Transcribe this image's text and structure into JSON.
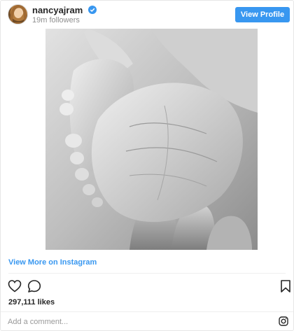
{
  "post": {
    "username": "nancyajram",
    "followers": "19m followers",
    "view_profile_label": "View Profile",
    "view_more_label": "View More on Instagram",
    "likes": "297,111 likes",
    "comment_placeholder": "Add a comment...",
    "photo_description_icon": "baby-feet-photo"
  },
  "colors": {
    "accent": "#3897f0",
    "text": "#262626",
    "muted": "#8e8e8e",
    "border": "#e6e6e6"
  },
  "icons": [
    "verified-badge-icon",
    "heart-icon",
    "comment-icon",
    "bookmark-icon",
    "instagram-icon"
  ]
}
